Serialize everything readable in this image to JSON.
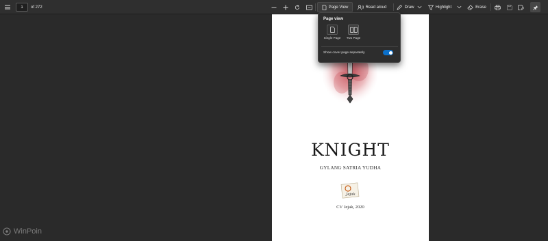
{
  "toolbar": {
    "current_page": "1",
    "page_count": "of 272",
    "page_view_label": "Page View",
    "read_aloud_label": "Read aloud",
    "draw_label": "Draw",
    "highlight_label": "Highlight",
    "erase_label": "Erase"
  },
  "document": {
    "title": "KNIGHT",
    "author": "GYLANG SATRIA YUDHA",
    "publisher": "CV Jejak, 2020",
    "logo_text": "Jejak"
  },
  "flyout": {
    "title": "Page view",
    "options": [
      {
        "label": "Single Page"
      },
      {
        "label": "Two Page"
      }
    ],
    "cover_label": "Show cover page separately",
    "cover_enabled": true
  },
  "watermark": "WinPoin",
  "colors": {
    "accent": "#0b6fc9",
    "toolbar_bg": "#2f2f2f",
    "canvas_bg": "#2a2a2a",
    "flyout_bg": "#2d2d2d"
  }
}
